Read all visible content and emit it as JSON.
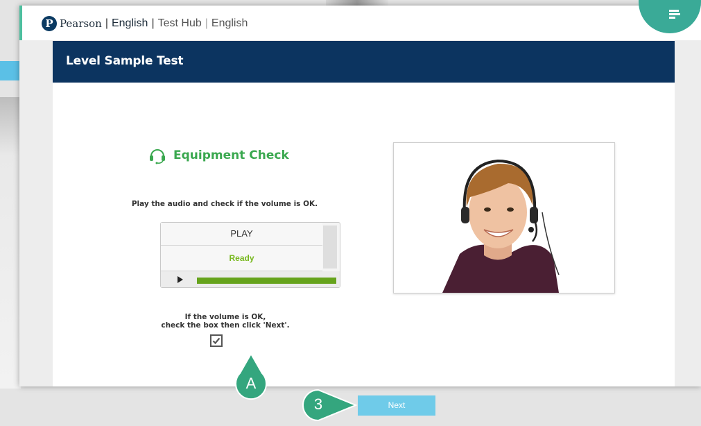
{
  "topbar": {
    "brand_logo_letter": "P",
    "brand_name": "Pearson",
    "product": "English",
    "app": "Test Hub",
    "language": "English",
    "menu_icon": "menu-icon",
    "accent_color": "#3aaa97"
  },
  "panel": {
    "title": "Level Sample Test",
    "header_color": "#0c3460"
  },
  "equipment_check": {
    "heading": "Equipment Check",
    "heading_icon": "headset-icon",
    "instruction": "Play the audio and check if the volume is OK.",
    "player": {
      "play_label": "PLAY",
      "status": "Ready",
      "play_icon": "play-icon",
      "progress": 1.0
    },
    "confirm_line1": "If the volume is OK,",
    "confirm_line2": "check the box then click 'Next'.",
    "checkbox_checked": true
  },
  "annotations": {
    "callout_a": "A",
    "callout_3": "3",
    "color": "#34a67e"
  },
  "next_label": "Next"
}
